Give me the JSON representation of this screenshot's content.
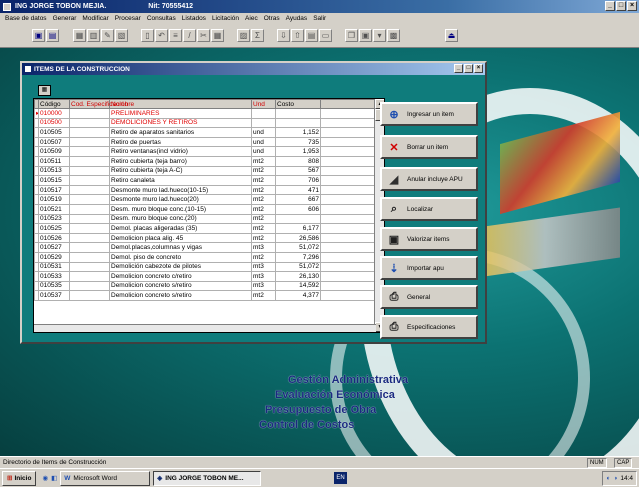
{
  "app": {
    "title": "ING JORGE TOBON MEJIA.",
    "nit": "Nit: 70555412",
    "min_label": "_",
    "max_label": "□",
    "close_label": "×"
  },
  "menu": [
    "Base de datos",
    "Generar",
    "Modificar",
    "Procesar",
    "Consultas",
    "Listados",
    "Licitación",
    "Aiec",
    "Otras",
    "Ayudas",
    "Salir"
  ],
  "child_window": {
    "title": "ITEMS DE LA CONSTRUCCION",
    "min_label": "_",
    "max_label": "□",
    "close_label": "×"
  },
  "grid": {
    "columns": [
      "Código",
      "Cod. Especificación",
      "Nombre",
      "Und",
      "Costo"
    ],
    "rows": [
      [
        "010000",
        "",
        "PRELIMINARES",
        "",
        ""
      ],
      [
        "010500",
        "",
        "DEMOLICIONES Y RETIROS",
        "",
        ""
      ],
      [
        "010505",
        "",
        "Retiro de aparatos sanitarios",
        "und",
        "1,152"
      ],
      [
        "010507",
        "",
        "Retiro de puertas",
        "und",
        "735"
      ],
      [
        "010509",
        "",
        "Retiro ventanas(incl vidrio)",
        "und",
        "1,953"
      ],
      [
        "010511",
        "",
        "Retiro cubierta (teja barro)",
        "mt2",
        "808"
      ],
      [
        "010513",
        "",
        "Retiro cubierta (teja A-C)",
        "mt2",
        "567"
      ],
      [
        "010515",
        "",
        "Retiro canaleta",
        "mt2",
        "706"
      ],
      [
        "010517",
        "",
        "Desmonte muro lad.hueco(10-15)",
        "mt2",
        "471"
      ],
      [
        "010519",
        "",
        "Desmonte muro lad.hueco(20)",
        "mt2",
        "667"
      ],
      [
        "010521",
        "",
        "Desm. muro bloque conc.(10-15)",
        "mt2",
        "606"
      ],
      [
        "010523",
        "",
        "Desm. muro bloque conc.(20)",
        "mt2",
        ""
      ],
      [
        "010525",
        "",
        "Demol. placas aligeradas (35)",
        "mt2",
        "6,177"
      ],
      [
        "010526",
        "",
        "Demolicion placa alig. 45",
        "mt2",
        "26,586"
      ],
      [
        "010527",
        "",
        "Demol.placas,columnas y vigas",
        "mt3",
        "51,072"
      ],
      [
        "010529",
        "",
        "Demol. piso de concreto",
        "mt2",
        "7,296"
      ],
      [
        "010531",
        "",
        "Demolición cabezote de pilotes",
        "mt3",
        "51,072"
      ],
      [
        "010533",
        "",
        "Demolicion concreto c/retiro",
        "mt3",
        "26,130"
      ],
      [
        "010535",
        "",
        "Demolicion concreto s/retiro",
        "mt3",
        "14,592"
      ],
      [
        "010537",
        "",
        "Demolicion concreto s/retiro",
        "mt2",
        "4,377"
      ]
    ]
  },
  "buttons": {
    "ingresar": "Ingresar un item",
    "borrar": "Borrar un item",
    "anular": "Anular incluye APU",
    "localizar": "Localizar",
    "valorizar": "Valorizar items",
    "importar": "Importar apu",
    "general": "General",
    "especificaciones": "Especificaciones"
  },
  "captions": {
    "line1": "Gestión Administrativa",
    "line2": "Evaluación Económica",
    "line3": "Presupuesto de Obra",
    "line4": "Control de Costos"
  },
  "status": {
    "text": "Directorio de Items de Construcción",
    "num": "NUM",
    "cap": "CAP"
  },
  "taskbar": {
    "start": "Inicio",
    "word": "Microsoft Word",
    "app": "ING JORGE TOBON ME...",
    "lang": "EN",
    "clock": "14:4"
  }
}
